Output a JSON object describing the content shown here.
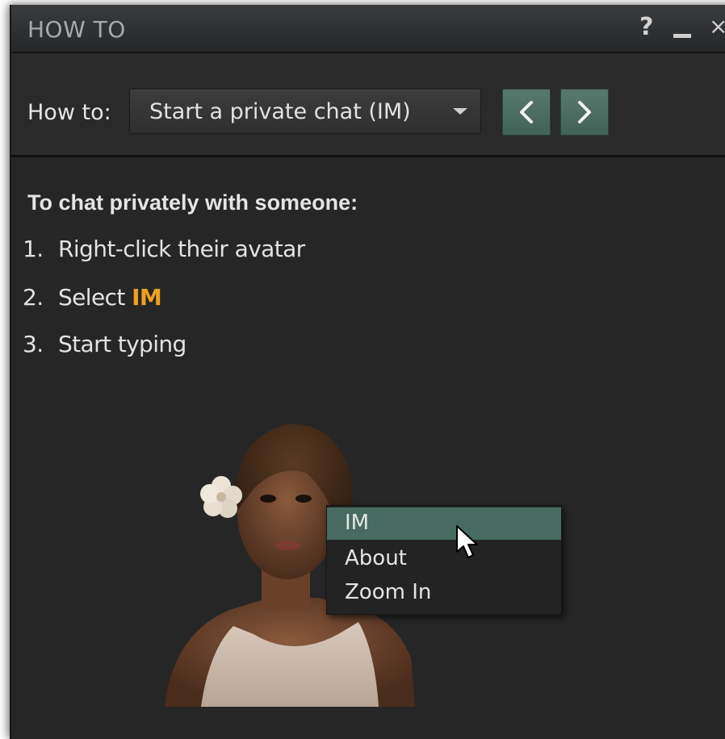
{
  "window": {
    "title": "HOW TO"
  },
  "titlebar": {
    "help_label": "?"
  },
  "toolbar": {
    "how_to_label": "How to:",
    "selected_topic": "Start a private chat (IM)",
    "prev_icon": "chevron-left-icon",
    "next_icon": "chevron-right-icon"
  },
  "content": {
    "heading": "To chat privately with someone:",
    "steps": [
      {
        "number": "1.",
        "text": "Right-click their avatar"
      },
      {
        "number": "2.",
        "text": "Select ",
        "highlight": "IM"
      },
      {
        "number": "3.",
        "text": "Start typing"
      }
    ]
  },
  "illustration": {
    "context_menu": [
      "IM",
      "About",
      "Zoom In"
    ],
    "highlighted_item": "IM"
  },
  "colors": {
    "accent_green": "#476b60",
    "highlight_orange": "#f0a020",
    "panel_bg": "#262626"
  }
}
